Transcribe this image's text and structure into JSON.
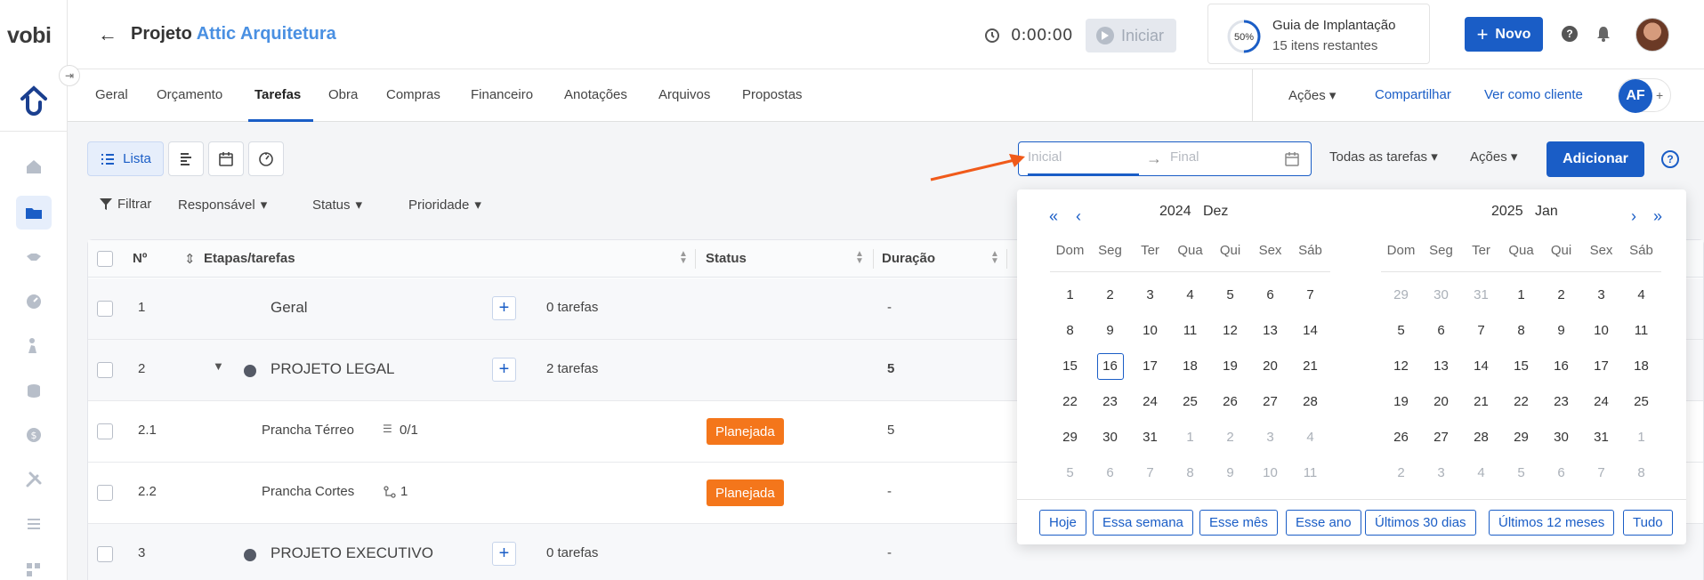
{
  "app": {
    "logo_text": "vobi"
  },
  "header": {
    "title_prefix": "Projeto",
    "project_name": "Attic Arquitetura",
    "timer": "0:00:00",
    "start_label": "Iniciar",
    "guide": {
      "percent": "50%",
      "title": "Guia de Implantação",
      "subtitle": "15 itens restantes"
    },
    "new_label": "Novo",
    "help_label": "?"
  },
  "tabs": [
    "Geral",
    "Orçamento",
    "Tarefas",
    "Obra",
    "Compras",
    "Financeiro",
    "Anotações",
    "Arquivos",
    "Propostas"
  ],
  "active_tab": "Tarefas",
  "tabs_right": {
    "actions": "Ações",
    "share": "Compartilhar",
    "view_as_client": "Ver como cliente",
    "user_initials": "AF",
    "add_user": "+"
  },
  "toolbar": {
    "list_label": "Lista",
    "date_start_placeholder": "Inicial",
    "date_end_placeholder": "Final",
    "all_tasks": "Todas as tarefas",
    "actions": "Ações",
    "add_label": "Adicionar",
    "help_label": "?"
  },
  "filters": {
    "filter": "Filtrar",
    "responsible": "Responsável",
    "status": "Status",
    "priority": "Prioridade"
  },
  "table": {
    "headers": {
      "number": "Nº",
      "tasks": "Etapas/tarefas",
      "status": "Status",
      "duration": "Duração"
    },
    "rows": [
      {
        "num": "1",
        "name": "Geral",
        "count": "0 tarefas",
        "status": "",
        "duration": "-"
      },
      {
        "num": "2",
        "name": "PROJETO LEGAL",
        "count": "2 tarefas",
        "status": "",
        "duration": "5"
      },
      {
        "num": "2.1",
        "name": "Prancha Térreo",
        "meta": "0/1",
        "status": "Planejada",
        "duration": "5"
      },
      {
        "num": "2.2",
        "name": "Prancha Cortes",
        "meta": "1",
        "status": "Planejada",
        "duration": "-"
      },
      {
        "num": "3",
        "name": "PROJETO EXECUTIVO",
        "count": "0 tarefas",
        "status": "",
        "duration": "-"
      }
    ]
  },
  "datepicker": {
    "left": {
      "year": "2024",
      "month": "Dez"
    },
    "right": {
      "year": "2025",
      "month": "Jan"
    },
    "weekdays": [
      "Dom",
      "Seg",
      "Ter",
      "Qua",
      "Qui",
      "Sex",
      "Sáb"
    ],
    "left_weeks": [
      [
        "1",
        "2",
        "3",
        "4",
        "5",
        "6",
        "7"
      ],
      [
        "8",
        "9",
        "10",
        "11",
        "12",
        "13",
        "14"
      ],
      [
        "15",
        "16",
        "17",
        "18",
        "19",
        "20",
        "21"
      ],
      [
        "22",
        "23",
        "24",
        "25",
        "26",
        "27",
        "28"
      ],
      [
        "29",
        "30",
        "31",
        "1",
        "2",
        "3",
        "4"
      ],
      [
        "5",
        "6",
        "7",
        "8",
        "9",
        "10",
        "11"
      ]
    ],
    "right_weeks": [
      [
        "29",
        "30",
        "31",
        "1",
        "2",
        "3",
        "4"
      ],
      [
        "5",
        "6",
        "7",
        "8",
        "9",
        "10",
        "11"
      ],
      [
        "12",
        "13",
        "14",
        "15",
        "16",
        "17",
        "18"
      ],
      [
        "19",
        "20",
        "21",
        "22",
        "23",
        "24",
        "25"
      ],
      [
        "26",
        "27",
        "28",
        "29",
        "30",
        "31",
        "1"
      ],
      [
        "2",
        "3",
        "4",
        "5",
        "6",
        "7",
        "8"
      ]
    ],
    "today": "16",
    "presets": [
      "Hoje",
      "Essa semana",
      "Esse mês",
      "Esse ano",
      "Últimos 30 dias",
      "Últimos 12 meses",
      "Tudo"
    ]
  },
  "colors": {
    "primary": "#1a5dc6",
    "link": "#4a90e2",
    "planned": "#f4761b",
    "annotation_arrow": "#f05a1a"
  }
}
